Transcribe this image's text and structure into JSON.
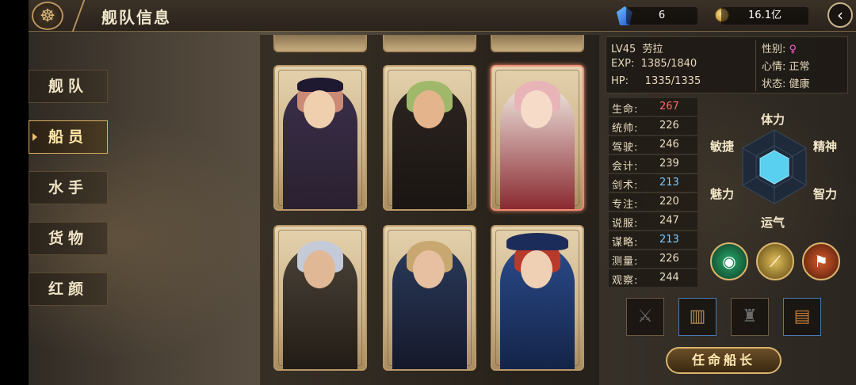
{
  "header": {
    "title": "舰队信息",
    "gems": "6",
    "gold": "16.1亿",
    "back_icon": "back-arrow-icon"
  },
  "menu": [
    {
      "label": "舰队",
      "active": false
    },
    {
      "label": "船员",
      "active": true
    },
    {
      "label": "水手",
      "active": false
    },
    {
      "label": "货物",
      "active": false
    },
    {
      "label": "红颜",
      "active": false
    }
  ],
  "info": {
    "level": "LV45",
    "name": "劳拉",
    "exp_label": "EXP:",
    "exp": "1385/1840",
    "hp_label": "HP:",
    "hp": "1335/1335",
    "gender_label": "性别:",
    "gender": "♀",
    "mood_label": "心情:",
    "mood": "正常",
    "status_label": "状态:",
    "status": "健康"
  },
  "stats": [
    {
      "key": "生命:",
      "value": "267",
      "color": "red"
    },
    {
      "key": "统帅:",
      "value": "226",
      "color": ""
    },
    {
      "key": "驾驶:",
      "value": "246",
      "color": ""
    },
    {
      "key": "会计:",
      "value": "239",
      "color": ""
    },
    {
      "key": "剑术:",
      "value": "213",
      "color": "blue"
    },
    {
      "key": "专注:",
      "value": "220",
      "color": ""
    },
    {
      "key": "说服:",
      "value": "247",
      "color": ""
    },
    {
      "key": "谋略:",
      "value": "213",
      "color": "blue"
    },
    {
      "key": "测量:",
      "value": "226",
      "color": ""
    },
    {
      "key": "观察:",
      "value": "244",
      "color": ""
    }
  ],
  "radar": {
    "labels": [
      "体力",
      "精神",
      "智力",
      "运气",
      "魅力",
      "敏捷"
    ]
  },
  "skills": [
    "eye-skill-icon",
    "spyglass-skill-icon",
    "banner-skill-icon"
  ],
  "equipment": [
    "sword-slot-icon",
    "coat-icon",
    "trophy-slot-icon",
    "book-icon"
  ],
  "appoint_label": "任命船长",
  "colors": {
    "accent": "#d9b56e",
    "selected": "#f08a70",
    "red": "#ff6a6a",
    "blue": "#7fc8ff",
    "female": "#ff5ac8"
  }
}
